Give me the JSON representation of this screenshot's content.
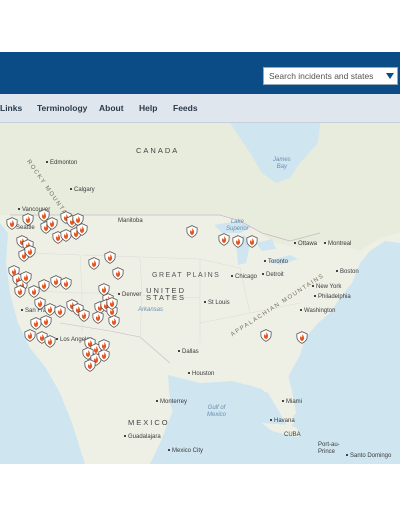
{
  "header": {
    "color": "#0c4c86"
  },
  "search": {
    "placeholder": "Search incidents and states",
    "icon": "triangle-down-icon"
  },
  "nav": {
    "items": [
      {
        "label": "Links"
      },
      {
        "label": "Terminology"
      },
      {
        "label": "About"
      },
      {
        "label": "Help"
      },
      {
        "label": "Feeds"
      }
    ]
  },
  "map": {
    "labels": {
      "canada": "CANADA",
      "rocky": "ROCKY MOUNTAINS",
      "great_plains": "GREAT PLAINS",
      "united_states": "UNITED\nSTATES",
      "appalachian": "APPALACHIAN MOUNTAINS",
      "mexico": "MEXICO",
      "gulf": "Gulf of\nMexico",
      "james_bay": "James\nBay",
      "lake_superior": "Lake\nSuperior",
      "manitoba": "Manitoba",
      "arkansas": "Arkansas",
      "edmonton": "Edmonton",
      "calgary": "Calgary",
      "vancouver": "Vancouver",
      "seattle": "Seattle",
      "ottawa": "Ottawa",
      "montreal": "Montreal",
      "toronto": "Toronto",
      "detroit": "Detroit",
      "chicago": "Chicago",
      "boston": "Boston",
      "new_york": "New York",
      "philadelphia": "Philadelphia",
      "washington": "Washington",
      "denver": "Denver",
      "st_louis": "St Louis",
      "san_francisco": "San Francisco",
      "los_angeles": "Los Angeles",
      "dallas": "Dallas",
      "houston": "Houston",
      "monterrey": "Monterrey",
      "miami": "Miami",
      "havana": "Havana",
      "cuba": "CUBA",
      "guadalajara": "Guadalajara",
      "mexico_city": "Mexico City",
      "port_au_prince": "Port-au-\nPrince",
      "santo_domingo": "Santo Domingo"
    },
    "fire_marker_icon": "fire-incident-icon",
    "fire_color": "#e8551f"
  }
}
